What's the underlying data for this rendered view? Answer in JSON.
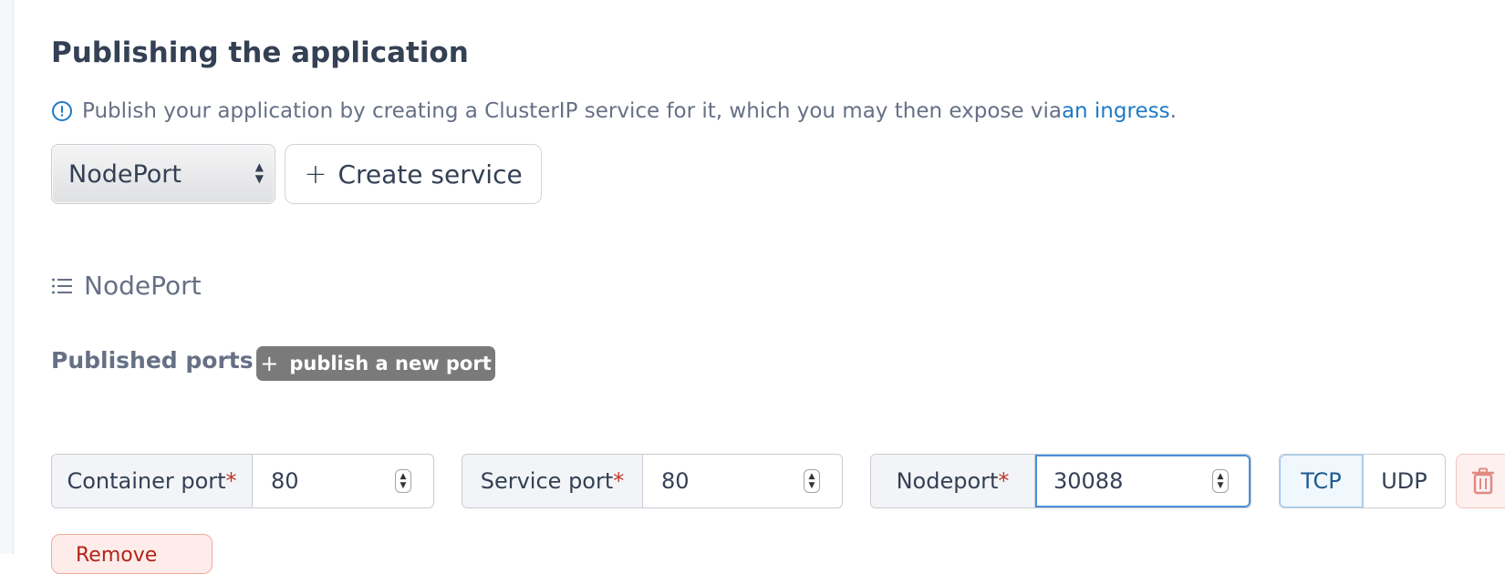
{
  "section": {
    "title": "Publishing the application",
    "info_text": "Publish your application by creating a ClusterIP service for it, which you may then expose via ",
    "info_link": "an ingress",
    "info_suffix": "."
  },
  "service_type_select": {
    "value": "NodePort"
  },
  "create_service_button": {
    "label": "Create service"
  },
  "service": {
    "name": "NodePort",
    "published_ports_label": "Published ports",
    "publish_new_port_label": "publish a new port"
  },
  "ports": [
    {
      "container_port_label": "Container port",
      "container_port_value": "80",
      "service_port_label": "Service port",
      "service_port_value": "80",
      "nodeport_label": "Nodeport",
      "nodeport_value": "30088",
      "required_marker": "*",
      "protocols": [
        "TCP",
        "UDP"
      ],
      "selected_protocol": "TCP"
    }
  ],
  "remove_button": {
    "label": "Remove"
  },
  "colors": {
    "link": "#1f7ac8",
    "required": "#c0392b",
    "danger": "#b42318",
    "publish_button_bg": "#7a7a7a"
  }
}
